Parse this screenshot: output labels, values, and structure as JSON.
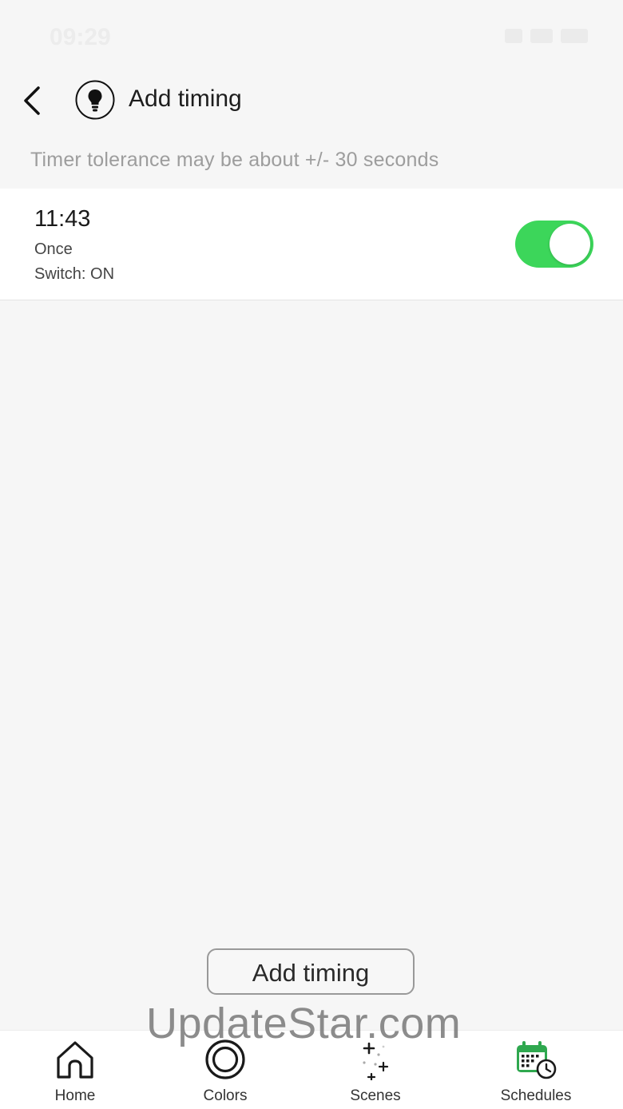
{
  "status_bar": {
    "time": "09:29"
  },
  "nav": {
    "title": "Add timing"
  },
  "hint": "Timer tolerance may be about +/- 30 seconds",
  "timers": [
    {
      "time": "11:43",
      "repeat": "Once",
      "action": "Switch: ON",
      "enabled": true
    }
  ],
  "add_button": "Add timing",
  "tabs": [
    {
      "label": "Home",
      "icon": "home-icon"
    },
    {
      "label": "Colors",
      "icon": "colors-icon"
    },
    {
      "label": "Scenes",
      "icon": "scenes-icon"
    },
    {
      "label": "Schedules",
      "icon": "schedules-icon",
      "active": true
    }
  ],
  "watermark": "UpdateStar.com",
  "colors": {
    "accent": "#3cd65a",
    "schedules_icon": "#2fa84f"
  }
}
